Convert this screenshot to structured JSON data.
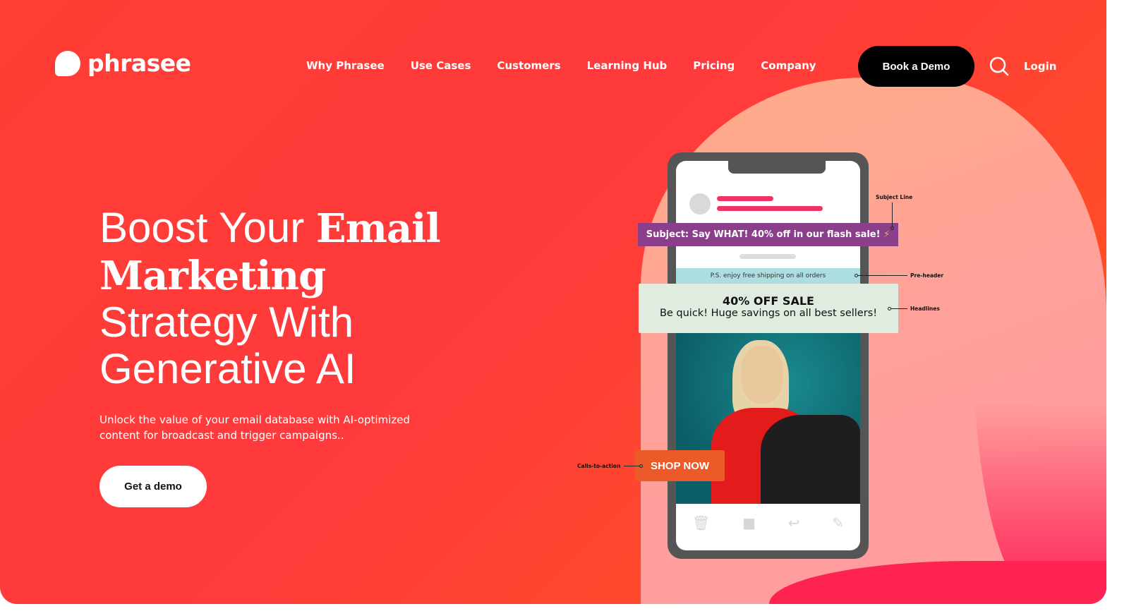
{
  "brand": {
    "name": "phrasee"
  },
  "nav": {
    "items": [
      "Why Phrasee",
      "Use Cases",
      "Customers",
      "Learning Hub",
      "Pricing",
      "Company"
    ],
    "book_demo": "Book a Demo",
    "login": "Login",
    "search_icon": "search-icon"
  },
  "hero": {
    "title_light_1": "Boost Your ",
    "title_bold_1": "Email",
    "title_bold_2": "Marketing",
    "title_light_2": "Strategy With",
    "title_light_3": "Generative AI",
    "subtitle": "Unlock the value of your email database with AI-optimized content for broadcast and trigger campaigns..",
    "cta": "Get a demo"
  },
  "mockup": {
    "subject": "Subject: Say WHAT! 40% off in our flash sale!",
    "subject_icon": "⚡",
    "preheader": "P.S. enjoy free shipping on all orders",
    "headline": "40% OFF SALE",
    "headline_sub": "Be quick! Huge savings on all best sellers!",
    "shop_now": "SHOP NOW",
    "annotations": {
      "subject_line": "Subject Line",
      "pre_header": "Pre-header",
      "headlines": "Headlines",
      "ctas": "Calls-to-action"
    },
    "toolbar_icons": [
      "trash-icon",
      "folder-icon",
      "reply-icon",
      "compose-icon"
    ]
  },
  "colors": {
    "background": "#ff3d33",
    "subject_bar": "#8b3f8a",
    "preheader": "#acdde0",
    "headline_box": "#e0ecdf",
    "shop_button": "#ec5a2a",
    "demo_button": "#000000"
  }
}
